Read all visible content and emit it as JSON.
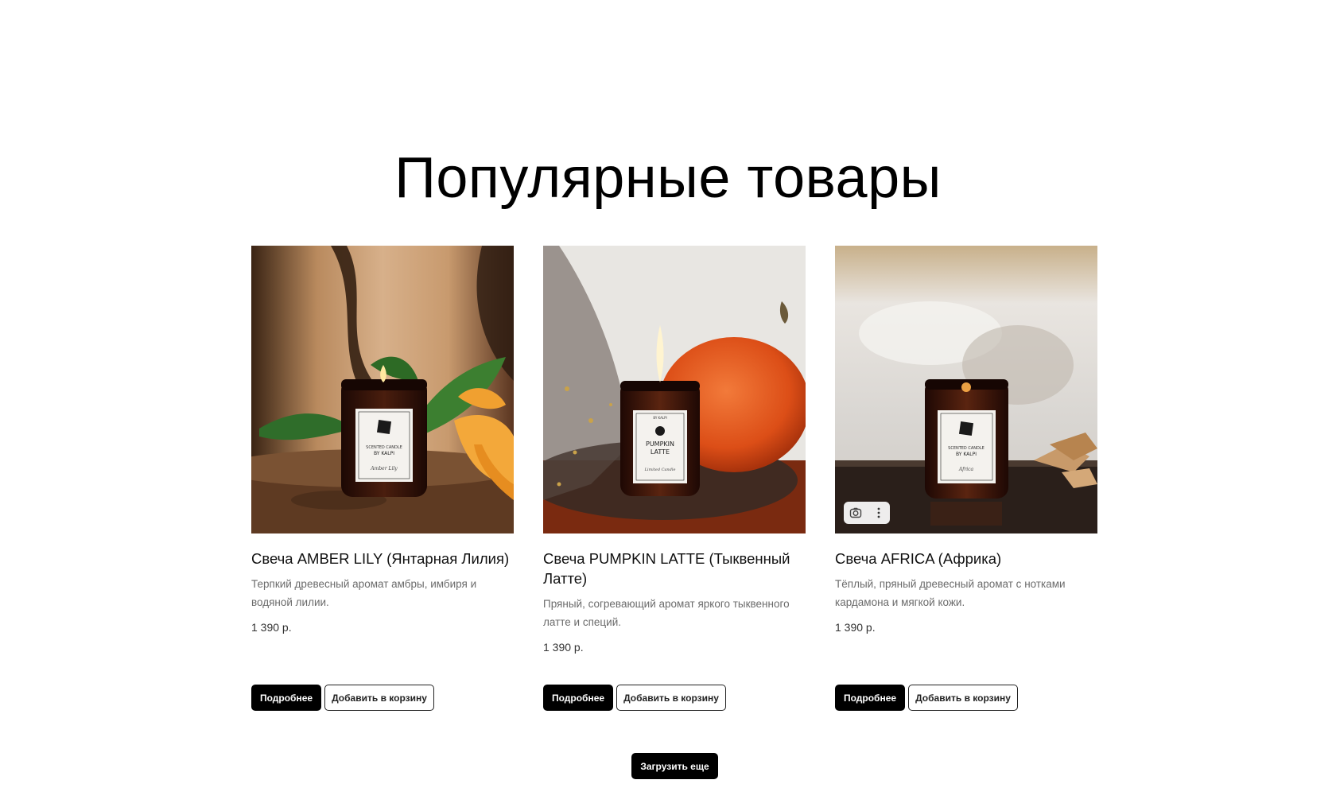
{
  "section": {
    "title": "Популярные товары"
  },
  "products": [
    {
      "title": "Свеча AMBER LILY (Янтарная Лилия)",
      "description": "Терпкий древесный аромат амбры, имбиря и водяной лилии.",
      "price": "1 390 р.",
      "details_label": "Подробнее",
      "cart_label": "Добавить в корзину",
      "label_top": "SCENTED CANDLE",
      "label_brand": "BY KALPI",
      "label_script": "Amber Lily"
    },
    {
      "title": "Свеча PUMPKIN LATTE (Тыквенный Латте)",
      "description": "Пряный, согревающий аромат яркого тыквенного латте и специй.",
      "price": "1 390 р.",
      "details_label": "Подробнее",
      "cart_label": "Добавить в корзину",
      "label_top": "BY KALPI",
      "label_brand": "PUMPKIN",
      "label_brand2": "LATTE",
      "label_script": "Limited Candle"
    },
    {
      "title": "Свеча AFRICA (Африка)",
      "description": "Тёплый, пряный древесный аромат с нотками кардамона и мягкой кожи.",
      "price": "1 390 р.",
      "details_label": "Подробнее",
      "cart_label": "Добавить в корзину",
      "label_top": "SCENTED CANDLE",
      "label_brand": "BY KALPI",
      "label_script": "Africa"
    }
  ],
  "load_more_label": "Загрузить еще",
  "icons": {
    "lens": "camera-search-icon",
    "more": "more-vertical-icon"
  },
  "colors": {
    "button_dark": "#000000",
    "text_primary": "#111111",
    "text_muted": "#6b6b6b",
    "pumpkin": "#e0531c",
    "lily": "#f0a030",
    "jar": "#3a160c"
  }
}
